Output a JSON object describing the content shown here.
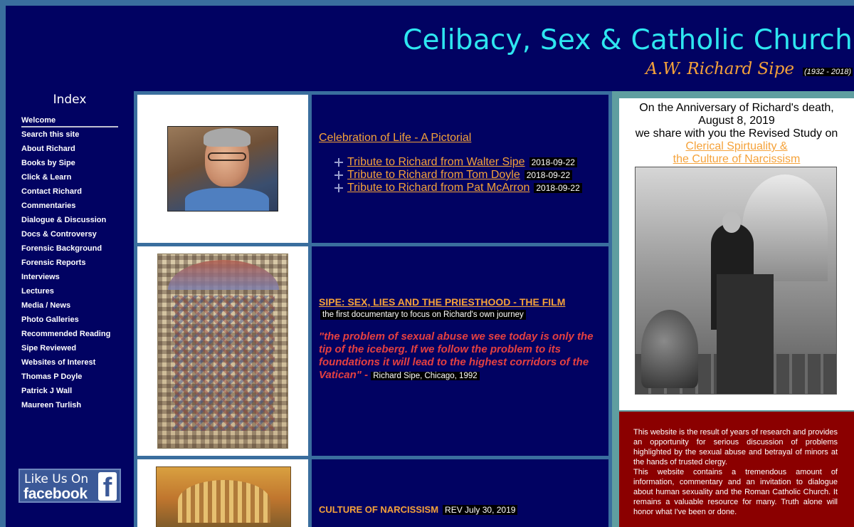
{
  "header": {
    "title": "Celibacy, Sex & Catholic Church",
    "author": "A.W. Richard Sipe",
    "dates": "(1932 - 2018)"
  },
  "sidebar": {
    "index_title": "Index",
    "items": [
      {
        "label": "Welcome"
      },
      {
        "label": "Search this site"
      },
      {
        "label": "About Richard"
      },
      {
        "label": "Books by Sipe"
      },
      {
        "label": "Click & Learn"
      },
      {
        "label": "Contact Richard"
      },
      {
        "label": "Commentaries"
      },
      {
        "label": "Dialogue & Discussion"
      },
      {
        "label": "Docs & Controversy"
      },
      {
        "label": "Forensic Background"
      },
      {
        "label": "Forensic Reports"
      },
      {
        "label": "Interviews"
      },
      {
        "label": "Lectures"
      },
      {
        "label": "Media / News"
      },
      {
        "label": "Photo Galleries"
      },
      {
        "label": "Recommended Reading"
      },
      {
        "label": "Sipe Reviewed"
      },
      {
        "label": "Websites of Interest"
      },
      {
        "label": "Thomas P Doyle"
      },
      {
        "label": "Patrick J Wall"
      },
      {
        "label": "Maureen Turlish"
      }
    ],
    "facebook": {
      "like_text": "Like Us On",
      "brand": "facebook",
      "glyph": "f"
    }
  },
  "celebration": {
    "link": "Celebration of Life - A Pictorial",
    "tributes": [
      {
        "label": "Tribute to Richard from Walter Sipe",
        "date": "2018-09-22"
      },
      {
        "label": "Tribute to Richard from Tom Doyle",
        "date": "2018-09-22"
      },
      {
        "label": "Tribute to Richard from Pat McArron",
        "date": "2018-09-22"
      }
    ]
  },
  "film": {
    "title": "SIPE: SEX, LIES AND THE PRIESTHOOD - THE FILM",
    "subtitle": "the first documentary to focus on Richard's own journey",
    "quote": "\"the problem of sexual abuse we see today is only the  tip of the iceberg. If we follow the problem to its foundations it will lead to the highest corridors of the Vatican\" - ",
    "attribution": "Richard Sipe, Chicago, 1992"
  },
  "narcissism": {
    "label": "CULTURE OF NARCISSISM",
    "rev": "REV July 30, 2019"
  },
  "announcement": {
    "line1": "On the Anniversary of Richard's death,",
    "line2": "August 8, 2019",
    "line3": "we share with you the Revised Study on",
    "link1": "Clerical Spirtuality &",
    "link2": "the Culture of Narcissism"
  },
  "about": {
    "p1": "This website is the result of years of research and provides an opportunity for serious discussion of problems highlighted by the sexual abuse and betrayal of  minors at the hands of trusted clergy.",
    "p2": "This website contains a tremendous amount of information, commentary and an invitation to dialogue about human sexuality and the Roman Catholic Church. It remains a valuable resource for many. Truth alone will honor what I've been or done."
  },
  "colors": {
    "navy": "#010262",
    "cyan": "#2ee6f0",
    "orange": "#f5a23a",
    "quote_red": "#e54040",
    "about_red": "#8b0000",
    "frame_blue": "#3a6e9e",
    "teal": "#5f9ea0"
  }
}
